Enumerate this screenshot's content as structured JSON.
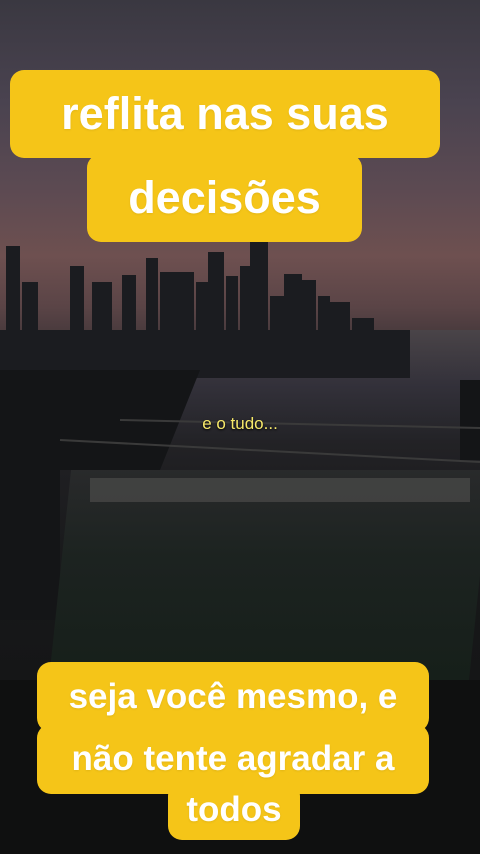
{
  "caption_top": {
    "line1": "reflita nas suas",
    "line2": "decisões"
  },
  "subtitle": "e o tudo...",
  "caption_bottom": {
    "line1": "seja você mesmo, e",
    "line2": "não tente agradar a",
    "line3": "todos"
  },
  "colors": {
    "caption_bg": "#f5c518",
    "caption_text": "#ffffff",
    "subtitle_text": "#f7e96a"
  }
}
